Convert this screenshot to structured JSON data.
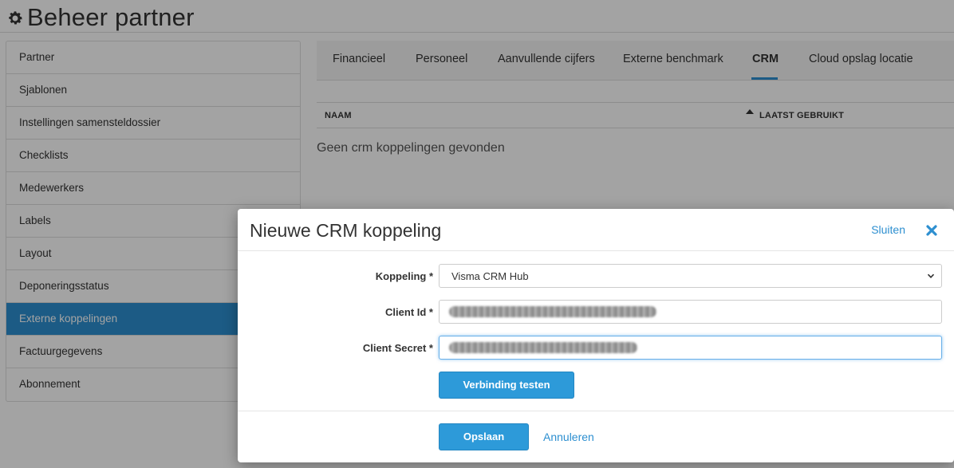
{
  "header": {
    "title": "Beheer partner",
    "icon": "gear-icon"
  },
  "sidebar": {
    "items": [
      {
        "label": "Partner"
      },
      {
        "label": "Sjablonen"
      },
      {
        "label": "Instellingen samensteldossier"
      },
      {
        "label": "Checklists"
      },
      {
        "label": "Medewerkers"
      },
      {
        "label": "Labels"
      },
      {
        "label": "Layout"
      },
      {
        "label": "Deponeringsstatus"
      },
      {
        "label": "Externe koppelingen"
      },
      {
        "label": "Factuurgegevens"
      },
      {
        "label": "Abonnement"
      }
    ],
    "active_index": 8
  },
  "tabs": [
    {
      "label": "Financieel"
    },
    {
      "label": "Personeel"
    },
    {
      "label": "Aanvullende cijfers"
    },
    {
      "label": "Externe benchmark"
    },
    {
      "label": "CRM"
    },
    {
      "label": "Cloud opslag locatie"
    }
  ],
  "active_tab": "CRM",
  "table": {
    "columns": [
      "NAAM",
      "LAATST GEBRUIKT"
    ],
    "empty_message": "Geen crm koppelingen gevonden"
  },
  "modal": {
    "title": "Nieuwe CRM koppeling",
    "close_label": "Sluiten",
    "fields": {
      "koppeling_label": "Koppeling *",
      "koppeling_value": "Visma CRM Hub",
      "client_id_label": "Client Id *",
      "client_secret_label": "Client Secret *"
    },
    "test_button": "Verbinding testen",
    "save_button": "Opslaan",
    "cancel_label": "Annuleren"
  },
  "colors": {
    "accent": "#2d8fd0",
    "button": "#2d9ad9"
  }
}
